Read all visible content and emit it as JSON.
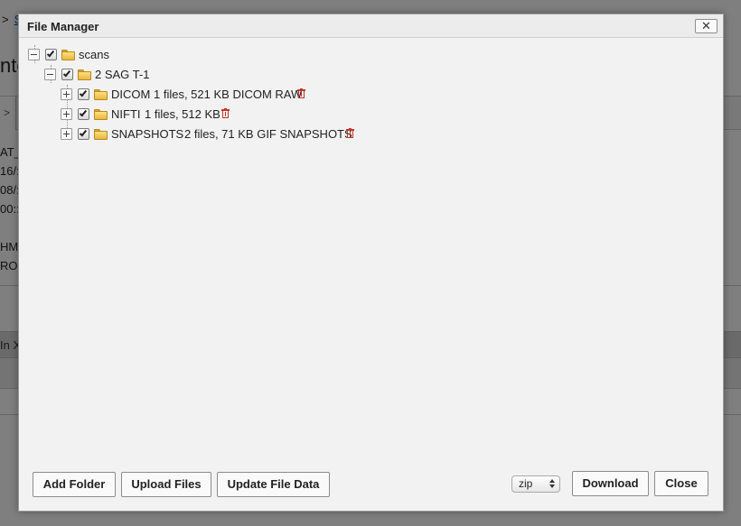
{
  "background": {
    "breadcrumb_sep": ">",
    "breadcrumb_link": "S",
    "title_fragment": "nte",
    "tab_label": ">",
    "meta_lines": [
      "AT_",
      "16/:",
      "08/:",
      "00::"
    ],
    "meta_lines2": [
      "HMI",
      "RO"
    ],
    "bar_text": "In X"
  },
  "dialog": {
    "title": "File Manager",
    "close_label": "✕",
    "tree": {
      "root": {
        "label": "scans",
        "checked": true,
        "expanded": true
      },
      "session": {
        "label": "2 SAG T-1",
        "checked": true,
        "expanded": true
      },
      "resources": [
        {
          "label": "DICOM",
          "info": "1 files, 521 KB DICOM RAW",
          "checked": true,
          "expanded": false
        },
        {
          "label": "NIFTI",
          "info": "1 files, 512 KB",
          "checked": true,
          "expanded": false
        },
        {
          "label": "SNAPSHOTS",
          "info": "2 files, 71 KB GIF SNAPSHOTS",
          "checked": true,
          "expanded": false
        }
      ]
    },
    "footer": {
      "add_folder": "Add Folder",
      "upload_files": "Upload Files",
      "update_file_data": "Update File Data",
      "format_selected": "zip",
      "download": "Download",
      "close": "Close"
    }
  },
  "colors": {
    "overlay": "rgba(0,0,0,0.5)",
    "dialog_bg": "#f2f2f2",
    "trash": "#c0392b",
    "folder": "#e8b842"
  },
  "icons": [
    "folder-icon",
    "trash-icon",
    "checkbox-checked-icon",
    "expand-plus-icon",
    "collapse-minus-icon",
    "close-icon",
    "select-arrows-icon"
  ]
}
